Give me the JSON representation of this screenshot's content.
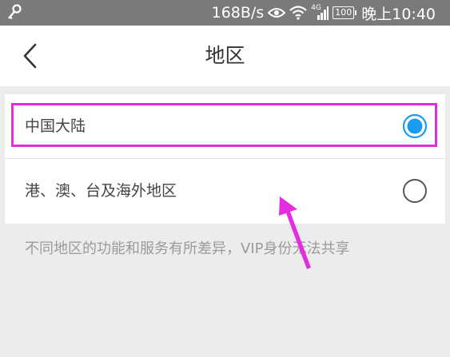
{
  "status_bar": {
    "network_speed": "168B/s",
    "signal_label": "4G",
    "battery": "100",
    "time": "晚上10:40",
    "icons": [
      "key-icon",
      "eye-icon",
      "wifi-icon",
      "cellular-signal-icon",
      "battery-icon"
    ]
  },
  "header": {
    "title": "地区",
    "back_icon": "chevron-left-icon"
  },
  "regions": [
    {
      "label": "中国大陆",
      "selected": true
    },
    {
      "label": "港、澳、台及海外地区",
      "selected": false
    }
  ],
  "note": "不同地区的功能和服务有所差异，VIP身份无法共享",
  "colors": {
    "status_bar": "#7a7a7a",
    "radio_selected": "#1a9cf0",
    "radio_unselected": "#555555",
    "highlight_annotation": "#e22ee0"
  }
}
